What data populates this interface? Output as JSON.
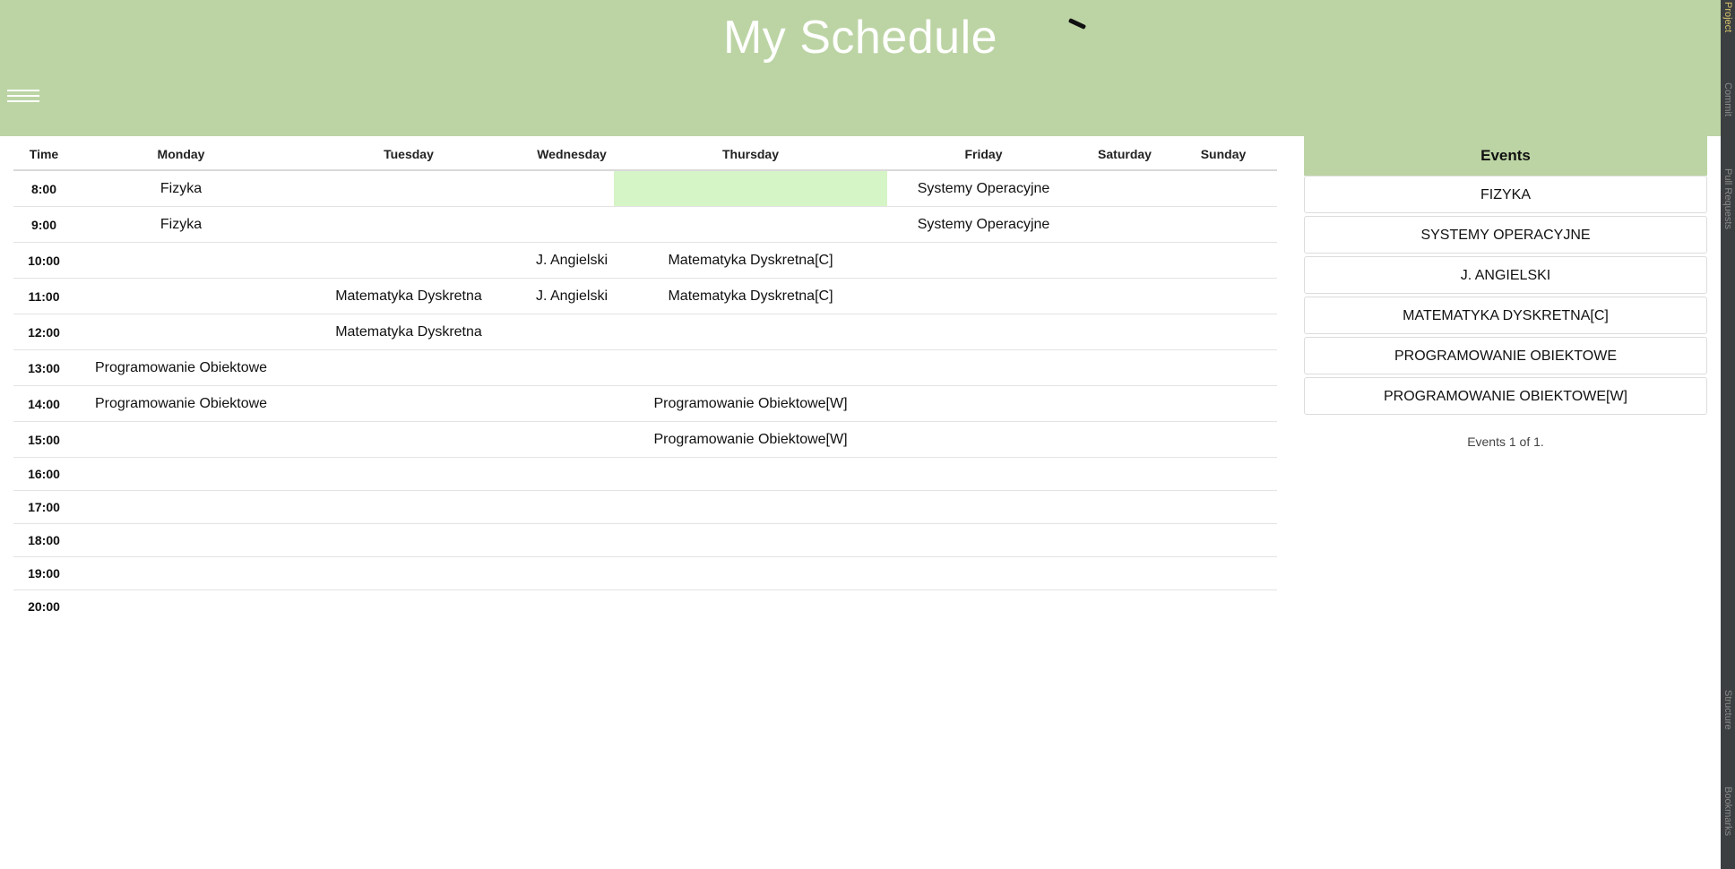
{
  "header": {
    "title": "My Schedule"
  },
  "schedule": {
    "columns": [
      "Time",
      "Monday",
      "Tuesday",
      "Wednesday",
      "Thursday",
      "Friday",
      "Saturday",
      "Sunday"
    ],
    "rows": [
      {
        "time": "8:00",
        "cells": [
          "Fizyka",
          "",
          "",
          "",
          "Systemy Operacyjne",
          "",
          ""
        ]
      },
      {
        "time": "9:00",
        "cells": [
          "Fizyka",
          "",
          "",
          "",
          "Systemy Operacyjne",
          "",
          ""
        ]
      },
      {
        "time": "10:00",
        "cells": [
          "",
          "",
          "J. Angielski",
          "Matematyka Dyskretna[C]",
          "",
          "",
          ""
        ]
      },
      {
        "time": "11:00",
        "cells": [
          "",
          "Matematyka Dyskretna",
          "J. Angielski",
          "Matematyka Dyskretna[C]",
          "",
          "",
          ""
        ]
      },
      {
        "time": "12:00",
        "cells": [
          "",
          "Matematyka Dyskretna",
          "",
          "",
          "",
          "",
          ""
        ]
      },
      {
        "time": "13:00",
        "cells": [
          "Programowanie Obiektowe",
          "",
          "",
          "",
          "",
          "",
          ""
        ]
      },
      {
        "time": "14:00",
        "cells": [
          "Programowanie Obiektowe",
          "",
          "",
          "Programowanie Obiektowe[W]",
          "",
          "",
          ""
        ]
      },
      {
        "time": "15:00",
        "cells": [
          "",
          "",
          "",
          "Programowanie Obiektowe[W]",
          "",
          "",
          ""
        ]
      },
      {
        "time": "16:00",
        "cells": [
          "",
          "",
          "",
          "",
          "",
          "",
          ""
        ]
      },
      {
        "time": "17:00",
        "cells": [
          "",
          "",
          "",
          "",
          "",
          "",
          ""
        ]
      },
      {
        "time": "18:00",
        "cells": [
          "",
          "",
          "",
          "",
          "",
          "",
          ""
        ]
      },
      {
        "time": "19:00",
        "cells": [
          "",
          "",
          "",
          "",
          "",
          "",
          ""
        ]
      },
      {
        "time": "20:00",
        "cells": [
          "",
          "",
          "",
          "",
          "",
          "",
          ""
        ]
      }
    ]
  },
  "events": {
    "title": "Events",
    "items": [
      "FIZYKA",
      "SYSTEMY OPERACYJNE",
      "J. ANGIELSKI",
      "MATEMATYKA DYSKRETNA[C]",
      "PROGRAMOWANIE OBIEKTOWE",
      "PROGRAMOWANIE OBIEKTOWE[W]"
    ],
    "footer": "Events 1 of 1."
  },
  "ide_sidebar": {
    "tabs": [
      "Project",
      "Commit",
      "Pull Requests",
      "Structure",
      "Bookmarks"
    ]
  },
  "colors": {
    "header_bg": "#bcd4a4",
    "highlight_cell": "#d6f5c6"
  }
}
